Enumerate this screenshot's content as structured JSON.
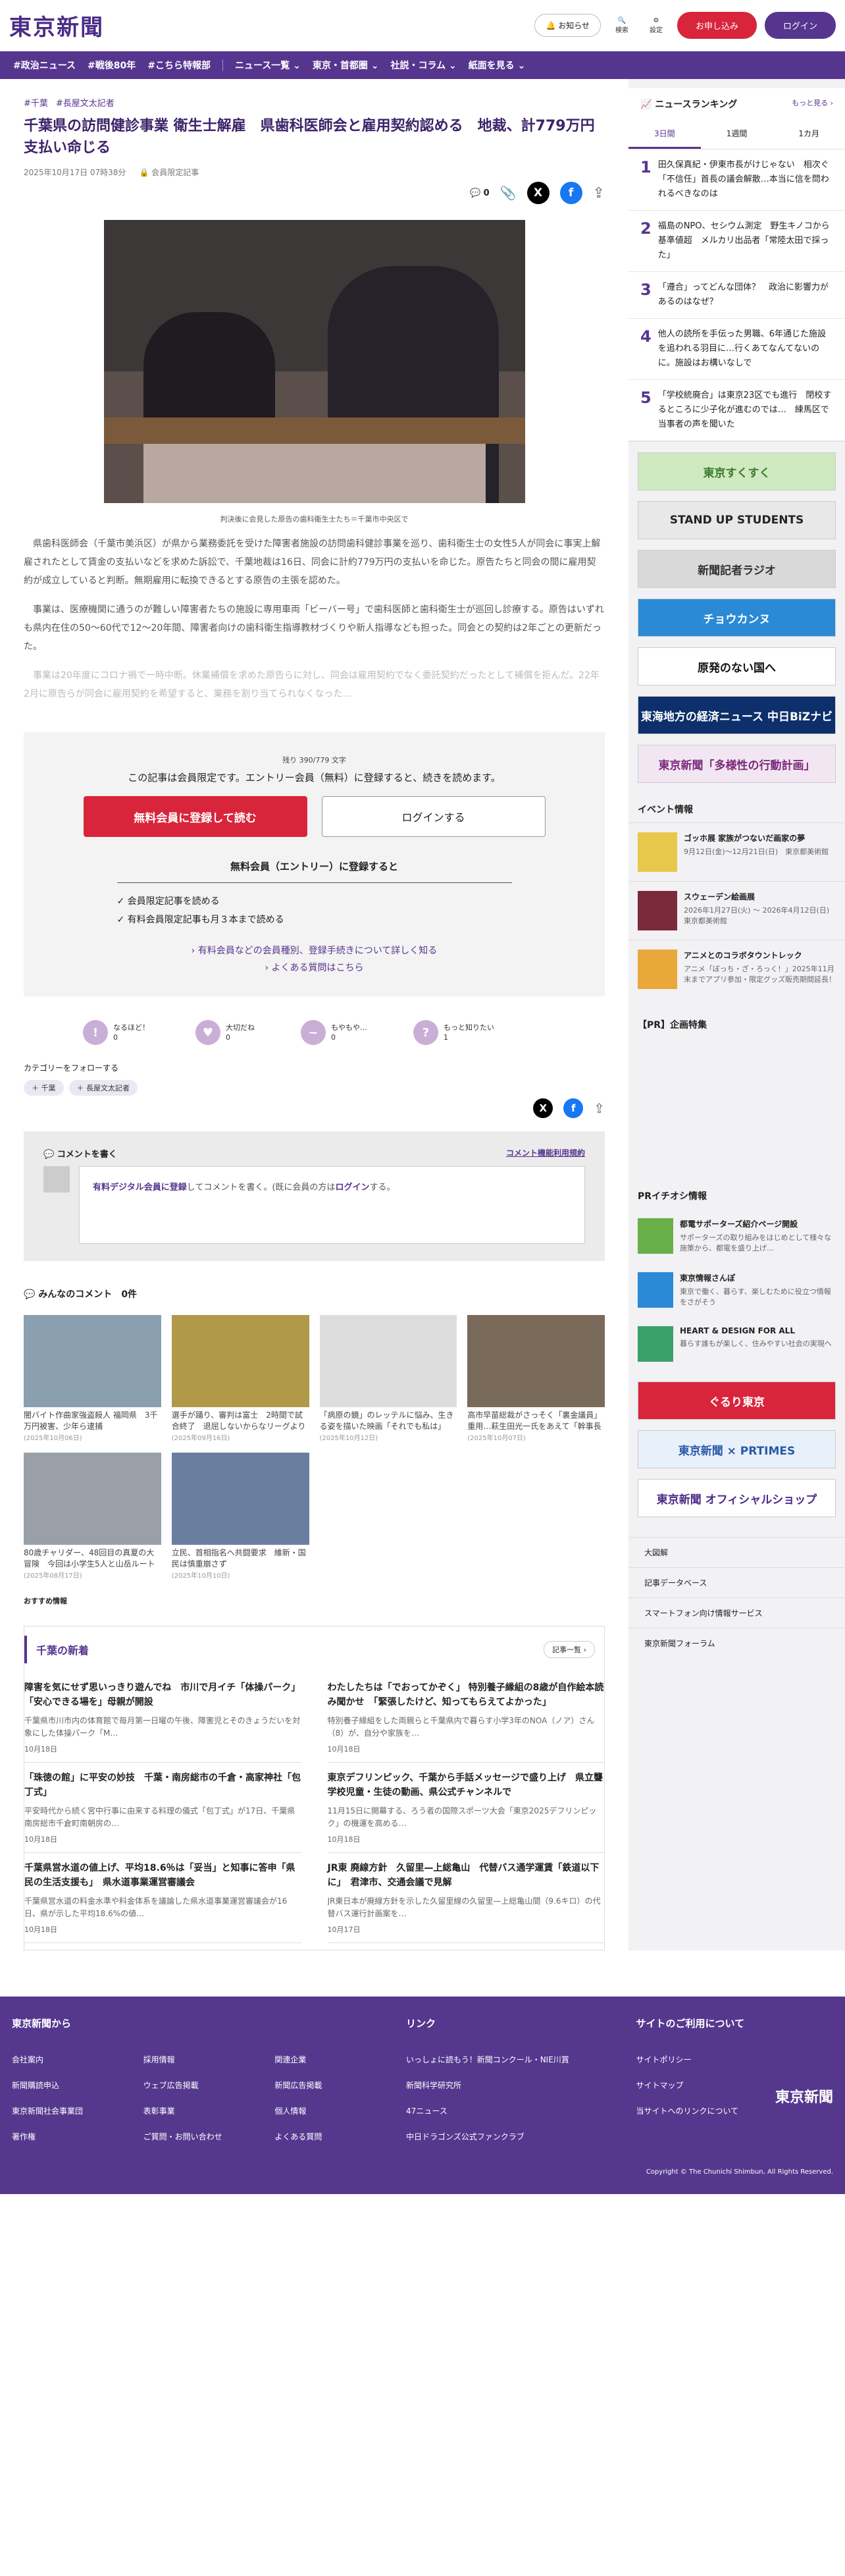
{
  "header": {
    "logo": "東京新聞",
    "notify": "お知らせ",
    "search": "検索",
    "settings": "設定",
    "subscribe": "お申し込み",
    "login": "ログイン"
  },
  "nav": [
    "#政治ニュース",
    "#戦後80年",
    "#こちら特報部",
    "ニュース一覧 ⌄",
    "東京・首都圏 ⌄",
    "社説・コラム ⌄",
    "紙面を見る ⌄"
  ],
  "article": {
    "tags": [
      "#千葉",
      "#長屋文太記者"
    ],
    "title": "千葉県の訪問健診事業 衛生士解雇　県歯科医師会と雇用契約認める　地裁、計779万円支払い命じる",
    "date": "2025年10月17日 07時38分",
    "members": "会員限定記事",
    "comments": "0",
    "caption": "判決後に会見した原告の歯科衛生士たち＝千葉市中央区で",
    "paragraphs": [
      "県歯科医師会（千葉市美浜区）が県から業務委託を受けた障害者施設の訪問歯科健診事業を巡り、歯科衛生士の女性5人が同会に事実上解雇されたとして賃金の支払いなどを求めた訴訟で、千葉地裁は16日、同会に計約779万円の支払いを命じた。原告たちと同会の間に雇用契約が成立していると判断。無期雇用に転換できるとする原告の主張を認めた。",
      "事業は、医療機関に通うのが難しい障害者たちの施設に専用車両「ビーバー号」で歯科医師と歯科衛生士が巡回し診療する。原告はいずれも県内在住の50～60代で12～20年間、障害者向けの歯科衛生指導教材づくりや新人指導なども担った。同会との契約は2年ごとの更新だった。"
    ],
    "faded": "事業は20年度にコロナ禍で一時中断。休業補償を求めた原告らに対し、同会は雇用契約でなく委託契約だったとして補償を拒んだ。22年2月に原告らが同会に雇用契約を希望すると、業務を割り当てられなくなった…"
  },
  "paywall": {
    "remain": "残り 390/779 文字",
    "msg": "この記事は会員限定です。エントリー会員（無料）に登録すると、続きを読めます。",
    "btn_free": "無料会員に登録して読む",
    "btn_login": "ログインする",
    "benefit_title": "無料会員（エントリー）に登録すると",
    "benefits": [
      "✓ 会員限定記事を読める",
      "✓ 有料会員限定記事も月３本まで読める"
    ],
    "links": [
      "› 有料会員などの会員種別、登録手続きについて詳しく知る",
      "› よくある質問はこちら"
    ]
  },
  "reactions": [
    {
      "label": "なるほど！",
      "count": "0",
      "icon": "!"
    },
    {
      "label": "大切だね",
      "count": "0",
      "icon": "♥"
    },
    {
      "label": "もやもや…",
      "count": "0",
      "icon": "~"
    },
    {
      "label": "もっと知りたい",
      "count": "1",
      "icon": "?"
    }
  ],
  "follow": {
    "title": "カテゴリーをフォローする",
    "tags": [
      "＋ 千葉",
      "＋ 長屋文太記者"
    ]
  },
  "comment": {
    "title": "コメントを書く",
    "terms": "コメント機能利用規約",
    "link": "有料デジタル会員に登録",
    "text": "してコメントを書く。(既に会員の方は",
    "login": "ログイン",
    "tail": "する。",
    "list": "みんなのコメント",
    "count": "0件"
  },
  "related": [
    {
      "t": "闇バイト作曲家強盗殺人 福岡県　3千万円被害、少年ら逮捕",
      "d": "(2025年10月06日)",
      "c": "#8a9fb0"
    },
    {
      "t": "選手が踊り、審判は富士　2時間で試合終了　退屈しないからなリーグより人気？「サバンナ…",
      "d": "(2025年09月16日)",
      "c": "#b09a4a"
    },
    {
      "t": "「病原の鏡」のレッテルに悩み、生きる姿を描いた映画「それでも私は」　加害者家族の人…",
      "d": "(2025年10月12日)",
      "c": "#ddd"
    },
    {
      "t": "高市早苗総裁がさっそく「裏金議員」重用…萩生田光一氏をあえて「幹事長代行」に起用し…",
      "d": "(2025年10月07日)",
      "c": "#7a6a5a"
    },
    {
      "t": "80歳チャリダー、48回目の真夏の大冒険　今回は小学生5人と山岳ルート1000キロ…平世紀不…",
      "d": "(2025年08月17日)",
      "c": "#9aa0a8"
    },
    {
      "t": "立民、首相指名へ共闘要求　維新・国民は慎重崩さず",
      "d": "(2025年10月10日)",
      "c": "#6a7fa0"
    }
  ],
  "reco": "おすすめ情報",
  "latest": {
    "title": "千葉の新着",
    "more": "記事一覧 ›",
    "items": [
      {
        "t": "障害を気にせず思いっきり遊んでね　市川で月イチ「体操パーク」「安心できる場を」母親が開設",
        "d": "千葉県市川市内の体育館で毎月第一日曜の午後、障害児とそのきょうだいを対象にした体操パーク「M…",
        "dt": "10月18日"
      },
      {
        "t": "わたしたちは「でおってかぞく」 特別養子縁組の8歳が自作絵本読み聞かせ　「緊張したけど、知ってもらえてよかった」",
        "d": "特別養子縁組をした両親らと千葉県内で暮らす小学3年のNOA（ノア）さん（8）が、自分や家族を…",
        "dt": "10月18日"
      },
      {
        "t": "「珠徳の館」に平安の妙技　千葉・南房総市の千倉・高家神社「包丁式」",
        "d": "平安時代から続く宮中行事に由来する料理の儀式「包丁式」が17日、千葉県南房総市千倉町南朝房の…",
        "dt": "10月18日"
      },
      {
        "t": "東京デフリンピック、千葉から手話メッセージで盛り上げ　県立聾学校児童・生徒の動画、県公式チャンネルで",
        "d": "11月15日に開幕する、ろう者の国際スポーツ大会「東京2025デフリンピック」の機運を高める…",
        "dt": "10月18日"
      },
      {
        "t": "千葉県営水道の値上げ、平均18.6％は「妥当」と知事に答申「県民の生活支援も」　県水道事業運営審議会",
        "d": "千葉県営水道の料金水準や料金体系を議論した県水道事業運営審議会が16日、県が示した平均18.6%の値…",
        "dt": "10月18日"
      },
      {
        "t": "JR東 廃線方針　久留里—上総亀山　代替バス通学運賃「鉄道以下に」　君津市、交通会議で見解",
        "d": "JR東日本が廃線方針を示した久留里線の久留里—上総亀山間（9.6キロ）の代替バス運行計画案を…",
        "dt": "10月17日"
      }
    ]
  },
  "ranking": {
    "title": "ニュースランキング",
    "more": "もっと見る ›",
    "tabs": [
      "3日間",
      "1週間",
      "1カ月"
    ],
    "items": [
      "田久保真紀・伊東市長がけじゃない　相次ぐ「不信任」首長の議会解散…本当に信を問われるべきなのは",
      "福島のNPO、セシウム測定　野生キノコから基準値超　メルカリ出品者「常陸太田で採った」",
      "「遵合」ってどんな団体？　政治に影響力があるのはなぜ？",
      "他人の読所を手伝った男職、6年通じた施設を追われる羽目に…行くあてなんてないのに。施設はお構いなしで",
      "「学校統廃合」は東京23区でも進行　閉校するところに少子化が進むのでは…　練馬区で当事者の声を聞いた"
    ]
  },
  "banners": [
    {
      "t": "東京すくすく",
      "bg": "#cfe9c0",
      "fg": "#3a7a2a"
    },
    {
      "t": "STAND UP STUDENTS",
      "bg": "#e8e8e8",
      "fg": "#222"
    },
    {
      "t": "新聞記者ラジオ",
      "bg": "#d9d9d9",
      "fg": "#333"
    },
    {
      "t": "チョウカンヌ",
      "bg": "#2a8ad6",
      "fg": "#fff"
    },
    {
      "t": "原発のない国へ",
      "bg": "#fff",
      "fg": "#111"
    },
    {
      "t": "東海地方の経済ニュース 中日BiZナビ",
      "bg": "#0d2f6b",
      "fg": "#fff"
    },
    {
      "t": "東京新聞「多様性の行動計画」",
      "bg": "#f2e6f2",
      "fg": "#7a2a7a"
    }
  ],
  "events": {
    "title": "イベント情報",
    "items": [
      {
        "t": "ゴッホ展 家族がつないだ画家の夢",
        "d": "9月12日(金)～12月21日(日)　東京都美術館",
        "c": "#e8c84a"
      },
      {
        "t": "スウェーデン絵画展",
        "d": "2026年1月27日(火) ～ 2026年4月12日(日)　東京都美術館",
        "c": "#7a2a3a"
      },
      {
        "t": "アニメとのコラボタウントレック",
        "d": "アニメ「ぼっち・ざ・ろっく！」2025年11月末までアプリ参加・限定グッズ販売期間延長！",
        "c": "#e8a83a"
      }
    ]
  },
  "pr": "【PR】企画特集",
  "pri": {
    "title": "PRイチオシ情報",
    "items": [
      {
        "t": "都電サポーターズ紹介ページ開設",
        "d": "サポーターズの取り組みをはじめとして様々な施策から、都電を盛り上げ…",
        "c": "#6ab04a"
      },
      {
        "t": "東京情報さんぽ",
        "d": "東京で働く、暮らす、楽しむために役立つ情報をさがそう",
        "c": "#2a8ad6"
      },
      {
        "t": "HEART & DESIGN FOR ALL",
        "d": "暮らす誰もが楽しく、住みやすい社会の実現へ",
        "c": "#3aa06a"
      }
    ]
  },
  "banners2": [
    {
      "t": "ぐるり東京",
      "bg": "#d8253b",
      "fg": "#fff"
    },
    {
      "t": "東京新聞 × PRTIMES",
      "bg": "#e8f0fa",
      "fg": "#2a5aa8"
    },
    {
      "t": "東京新聞 オフィシャルショップ",
      "bg": "#fff",
      "fg": "#4b2c87"
    }
  ],
  "sidelinks": [
    "大図解",
    "記事データベース",
    "スマートフォン向け情報サービス",
    "東京新聞フォーラム"
  ],
  "footer": {
    "cols": [
      {
        "h": "東京新聞から",
        "links": [
          "会社案内",
          "採用情報",
          "関連企業",
          "新聞購読申込",
          "ウェブ広告掲載",
          "新聞広告掲載",
          "東京新聞社会事業団",
          "表彰事業",
          "個人情報",
          "著作権",
          "ご質問・お問い合わせ",
          "よくある質問"
        ]
      },
      {
        "h": "リンク",
        "links": [
          "いっしょに読もう！新聞コンクール・NIE川賞",
          "新聞科学研究所",
          "47ニュース",
          "中日ドラゴンズ公式ファンクラブ"
        ]
      },
      {
        "h": "サイトのご利用について",
        "links": [
          "サイトポリシー",
          "サイトマップ",
          "当サイトへのリンクについて"
        ]
      }
    ],
    "logo": "東京新聞",
    "copy": "Copyright © The Chunichi Shimbun, All Rights Reserved."
  }
}
